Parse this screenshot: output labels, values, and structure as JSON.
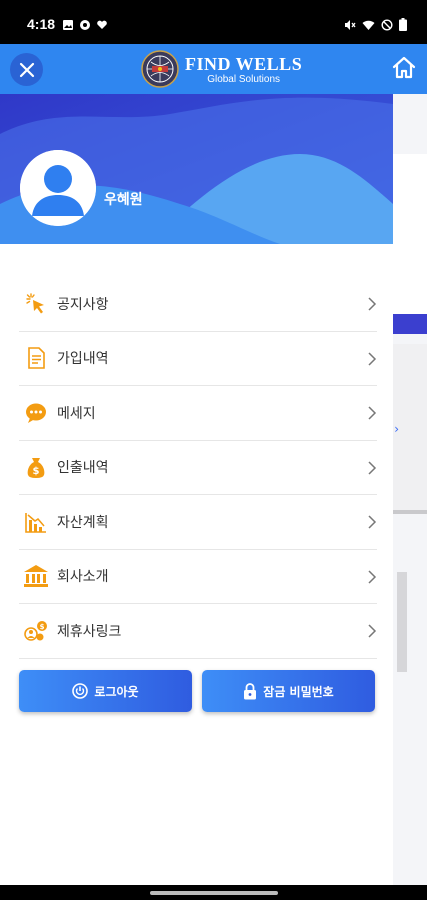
{
  "status_bar": {
    "time": "4:18",
    "left_icons": [
      "gallery-icon",
      "chrome-icon",
      "heart-icon"
    ],
    "right_icons": [
      "mute-icon",
      "wifi-icon",
      "do-not-disturb-icon",
      "battery-icon"
    ]
  },
  "header": {
    "logo_title": "FIND WELLS",
    "logo_subtitle": "Global Solutions",
    "close_icon": "close-icon",
    "home_icon": "home-icon",
    "color": "#2f86f0"
  },
  "profile": {
    "name": "우혜원"
  },
  "menu": {
    "items": [
      {
        "label": "공지사항",
        "icon": "click-pointer-icon"
      },
      {
        "label": "가입내역",
        "icon": "document-icon"
      },
      {
        "label": "메세지",
        "icon": "chat-bubble-icon"
      },
      {
        "label": "인출내역",
        "icon": "money-bag-icon"
      },
      {
        "label": "자산계획",
        "icon": "declining-chart-icon"
      },
      {
        "label": "회사소개",
        "icon": "bank-building-icon"
      },
      {
        "label": "제휴사링크",
        "icon": "partner-coins-icon"
      }
    ]
  },
  "buttons": {
    "logout": "로그아웃",
    "password": "잠금 비밀번호"
  },
  "colors": {
    "accent_orange": "#f39c12",
    "button_blue": "#2f5ce0"
  }
}
